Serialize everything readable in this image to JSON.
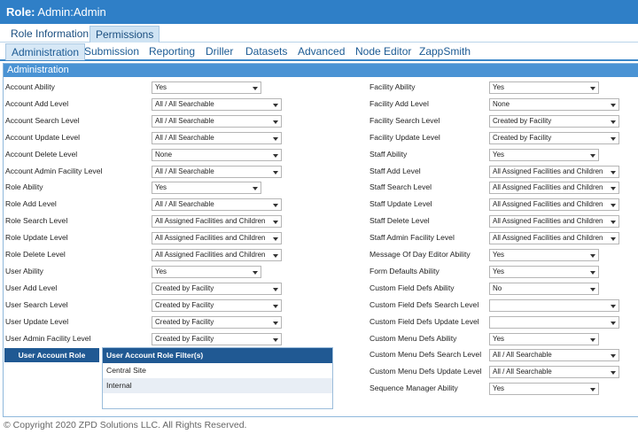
{
  "title": {
    "prefix": "Role:",
    "name": "Admin:Admin"
  },
  "primary_tabs": [
    {
      "label": "Role Information",
      "active": false
    },
    {
      "label": "Permissions",
      "active": true
    }
  ],
  "secondary_tabs": [
    {
      "label": "Administration",
      "active": true
    },
    {
      "label": "Submission",
      "active": false
    },
    {
      "label": "Reporting",
      "active": false
    },
    {
      "label": "Driller",
      "active": false
    },
    {
      "label": "Datasets",
      "active": false
    },
    {
      "label": "Advanced",
      "active": false
    },
    {
      "label": "Node Editor",
      "active": false
    },
    {
      "label": "ZappSmith",
      "active": false
    }
  ],
  "section": {
    "title": "Administration"
  },
  "left_fields": [
    {
      "label": "Account Ability",
      "value": "Yes"
    },
    {
      "label": "Account Add Level",
      "value": "All / All Searchable"
    },
    {
      "label": "Account Search Level",
      "value": "All / All Searchable"
    },
    {
      "label": "Account Update Level",
      "value": "All / All Searchable"
    },
    {
      "label": "Account Delete Level",
      "value": "None"
    },
    {
      "label": "Account Admin Facility Level",
      "value": "All / All Searchable"
    },
    {
      "label": "Role Ability",
      "value": "Yes"
    },
    {
      "label": "Role Add Level",
      "value": "All / All Searchable"
    },
    {
      "label": "Role Search Level",
      "value": "All Assigned Facilities and Children"
    },
    {
      "label": "Role Update Level",
      "value": "All Assigned Facilities and Children"
    },
    {
      "label": "Role Delete Level",
      "value": "All Assigned Facilities and Children"
    },
    {
      "label": "User Ability",
      "value": "Yes"
    },
    {
      "label": "User Add Level",
      "value": "Created by Facility"
    },
    {
      "label": "User Search Level",
      "value": "Created by Facility"
    },
    {
      "label": "User Update Level",
      "value": "Created by Facility"
    },
    {
      "label": "User Admin Facility Level",
      "value": "Created by Facility"
    }
  ],
  "right_fields": [
    {
      "label": "Facility Ability",
      "value": "Yes"
    },
    {
      "label": "Facility Add Level",
      "value": "None"
    },
    {
      "label": "Facility Search Level",
      "value": "Created by Facility"
    },
    {
      "label": "Facility Update Level",
      "value": "Created by Facility"
    },
    {
      "label": "Staff Ability",
      "value": "Yes"
    },
    {
      "label": "Staff Add Level",
      "value": "All Assigned Facilities and Children"
    },
    {
      "label": "Staff Search Level",
      "value": "All Assigned Facilities and Children"
    },
    {
      "label": "Staff Update Level",
      "value": "All Assigned Facilities and Children"
    },
    {
      "label": "Staff Delete Level",
      "value": "All Assigned Facilities and Children"
    },
    {
      "label": "Staff Admin Facility Level",
      "value": "All Assigned Facilities and Children"
    },
    {
      "label": "Message Of Day Editor Ability",
      "value": "Yes"
    },
    {
      "label": "Form Defaults Ability",
      "value": "Yes"
    },
    {
      "label": "Custom Field Defs Ability",
      "value": "No"
    },
    {
      "label": "Custom Field Defs Search Level",
      "value": ""
    },
    {
      "label": "Custom Field Defs Update Level",
      "value": ""
    },
    {
      "label": "Custom Menu Defs Ability",
      "value": "Yes"
    },
    {
      "label": "Custom Menu Defs Search Level",
      "value": "All / All Searchable"
    },
    {
      "label": "Custom Menu Defs Update Level",
      "value": "All / All Searchable"
    },
    {
      "label": "Sequence Manager Ability",
      "value": "Yes"
    }
  ],
  "filter": {
    "button_label": "User Account Role Filter(s)",
    "header": "User Account Role Filter(s)",
    "options": [
      {
        "label": "Central Site",
        "selected": false
      },
      {
        "label": "Internal",
        "selected": true
      }
    ]
  },
  "footer": {
    "copyright": "© Copyright 2020 ZPD Solutions LLC. All Rights Reserved."
  }
}
